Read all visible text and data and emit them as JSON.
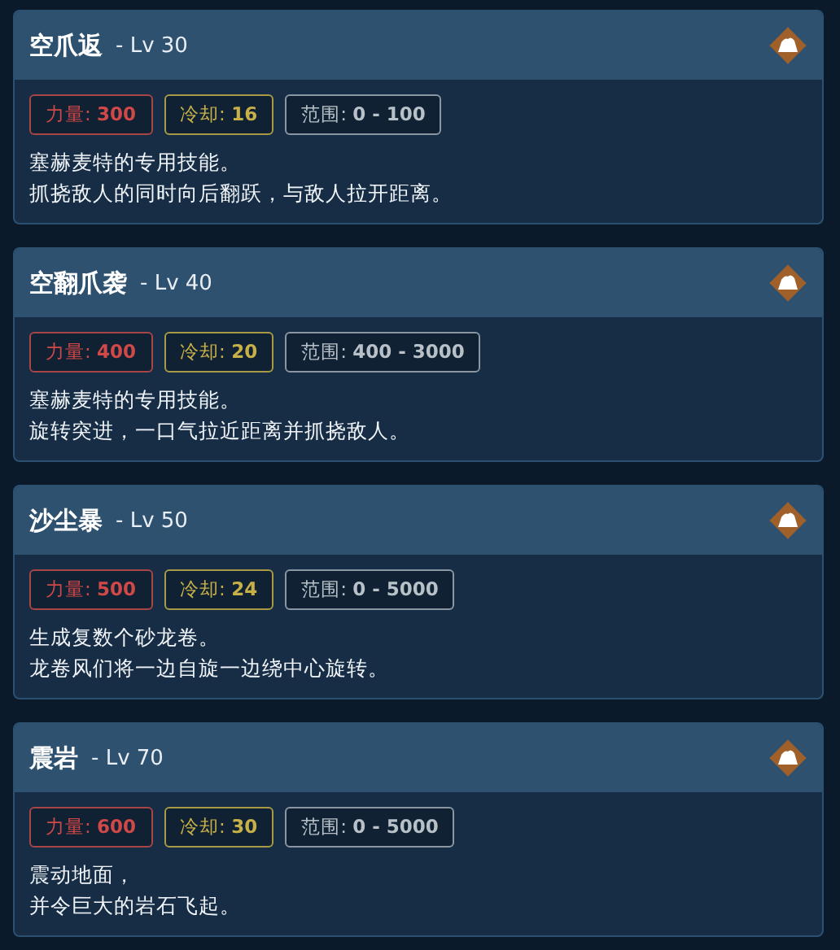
{
  "skills": [
    {
      "name": "空爪返",
      "level": "- Lv 30",
      "stats": [
        {
          "kind": "power",
          "text": "力量: **300**"
        },
        {
          "kind": "cooldown",
          "text": "冷却: **16**"
        },
        {
          "kind": "range",
          "text": "范围: **0 - 100**"
        }
      ],
      "description": [
        "塞赫麦特的专用技能。",
        "抓挠敌人的同时向后翻跃，与敌人拉开距离。"
      ]
    },
    {
      "name": "空翻爪袭",
      "level": "- Lv 40",
      "stats": [
        {
          "kind": "power",
          "text": "力量: **400**"
        },
        {
          "kind": "cooldown",
          "text": "冷却: **20**"
        },
        {
          "kind": "range",
          "text": "范围: **400 - 3000**"
        }
      ],
      "description": [
        "塞赫麦特的专用技能。",
        "旋转突进，一口气拉近距离并抓挠敌人。"
      ]
    },
    {
      "name": "沙尘暴",
      "level": "- Lv 50",
      "stats": [
        {
          "kind": "power",
          "text": "力量: **500**"
        },
        {
          "kind": "cooldown",
          "text": "冷却: **24**"
        },
        {
          "kind": "range",
          "text": "范围: **0 - 5000**"
        }
      ],
      "description": [
        "生成复数个砂龙卷。",
        "龙卷风们将一边自旋一边绕中心旋转。"
      ]
    },
    {
      "name": "震岩",
      "level": "- Lv 70",
      "stats": [
        {
          "kind": "power",
          "text": "力量: **600**"
        },
        {
          "kind": "cooldown",
          "text": "冷却: **30**"
        },
        {
          "kind": "range",
          "text": "范围: **0 - 5000**"
        }
      ],
      "description": [
        "震动地面，",
        "并令巨大的岩石飞起。"
      ]
    }
  ]
}
